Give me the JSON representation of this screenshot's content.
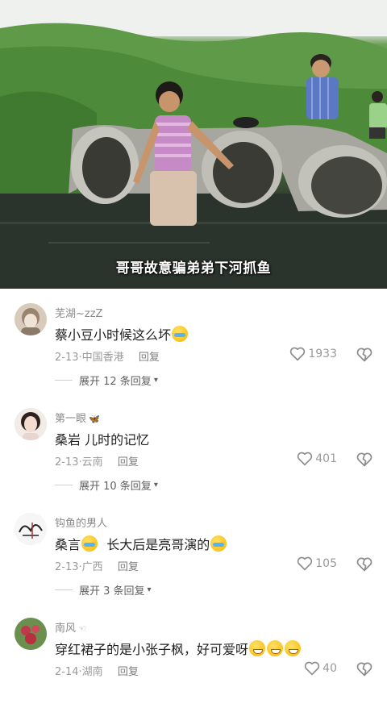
{
  "video": {
    "caption": "哥哥故意骗弟弟下河抓鱼"
  },
  "comments": [
    {
      "username": "芜湖~zzZ",
      "user_tag": "",
      "text_parts": [
        "蔡小豆小时候这么坏"
      ],
      "emoji_after": [
        "cry"
      ],
      "date": "2-13",
      "location": "中国香港",
      "reply_label": "回复",
      "likes": "1933",
      "expand_label": "展开 12 条回复",
      "avatar_colors": [
        "#c9b8a6",
        "#8c7a68"
      ]
    },
    {
      "username": "第一眼",
      "user_tag": "🦋",
      "text_parts": [
        "桑岩 儿时的记忆"
      ],
      "emoji_after": [],
      "date": "2-13",
      "location": "云南",
      "reply_label": "回复",
      "likes": "401",
      "expand_label": "展开 10 条回复",
      "avatar_colors": [
        "#f1e2dc",
        "#3a2c2a"
      ]
    },
    {
      "username": "钩鱼的男人",
      "user_tag": "",
      "text_parts": [
        "桑言",
        "长大后是亮哥演的"
      ],
      "emoji_after": [
        "cry",
        "cry"
      ],
      "date": "2-13",
      "location": "广西",
      "reply_label": "回复",
      "likes": "105",
      "expand_label": "展开 3 条回复",
      "avatar_colors": [
        "#f4f4f4",
        "#222222"
      ]
    },
    {
      "username": "南风",
      "user_tag": "☜",
      "text_parts": [
        "穿红裙子的是小张子枫，好可爱呀"
      ],
      "emoji_after": [
        "grin",
        "grin",
        "grin"
      ],
      "date": "2-14",
      "location": "湖南",
      "reply_label": "回复",
      "likes": "40",
      "expand_label": "",
      "avatar_colors": [
        "#6a8f4e",
        "#c0394a"
      ]
    }
  ],
  "icons": {
    "like": "heart-outline-icon",
    "dislike": "broken-heart-icon",
    "expand": "chevron-down-icon"
  },
  "colors": {
    "text": "#1f1f1f",
    "meta": "#9a9a9a",
    "username": "#8a8a8a"
  }
}
